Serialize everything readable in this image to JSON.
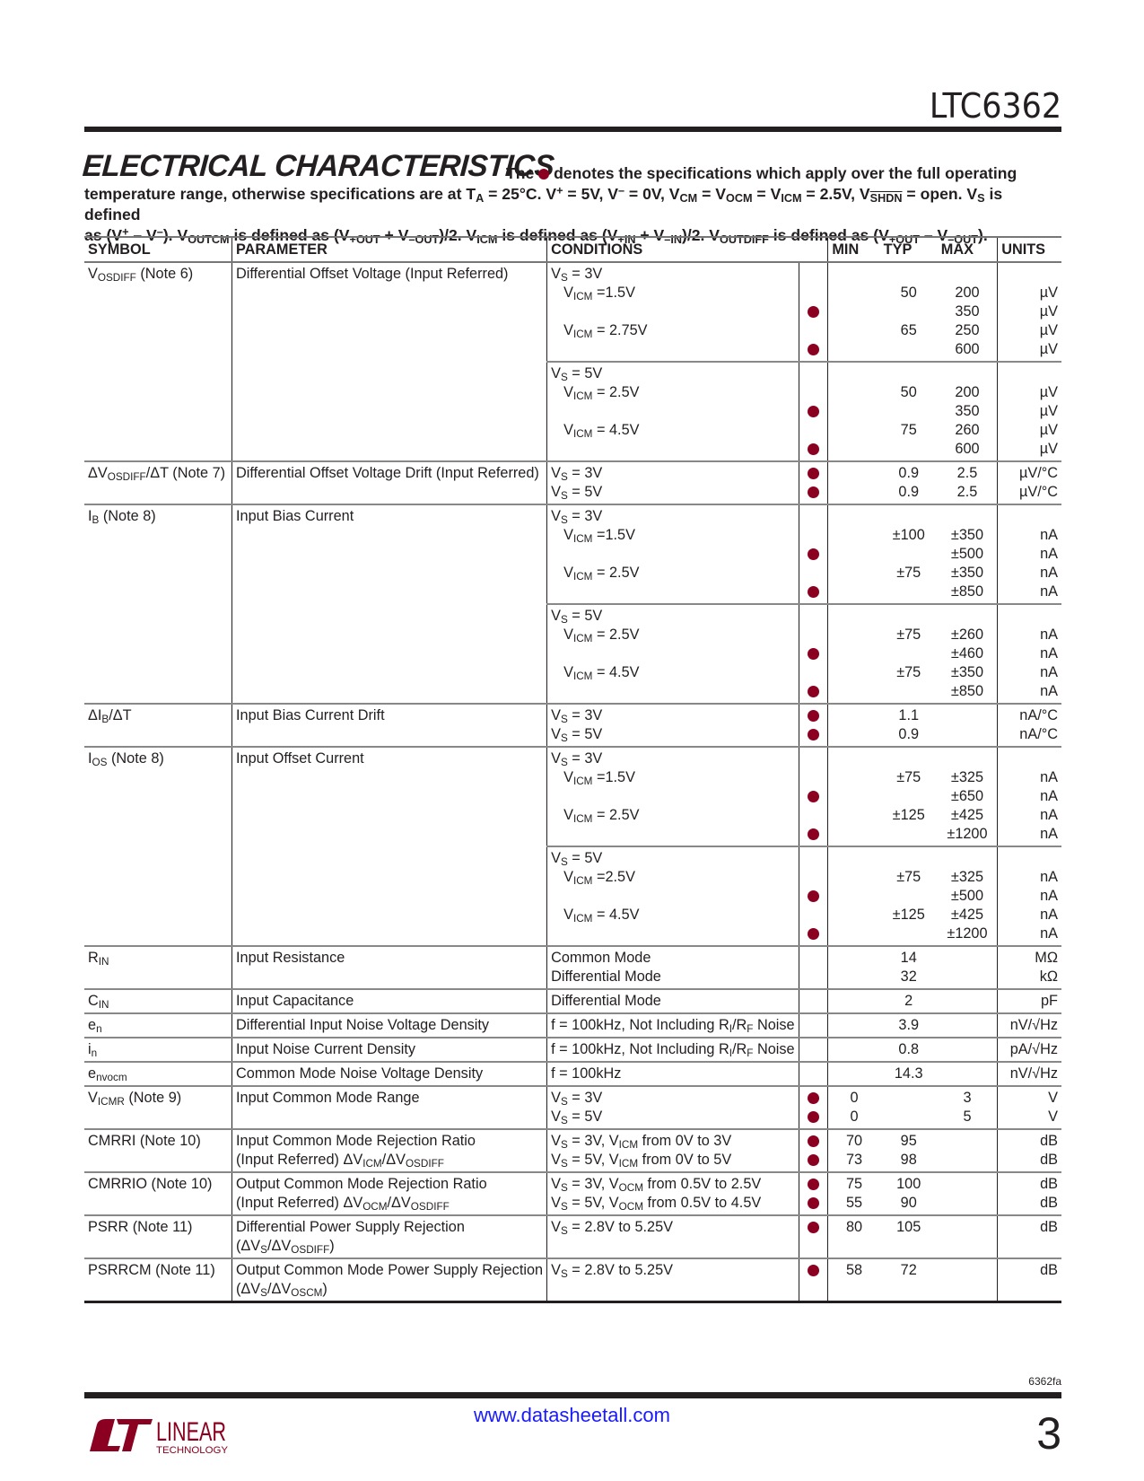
{
  "header": {
    "part_number": "LTC6362"
  },
  "section": {
    "title": "ELECTRICAL CHARACTERISTICS",
    "intro_the": "The",
    "intro_rest_1": "denotes the specifications which apply over the full operating",
    "intro_line_2": "temperature range, otherwise specifications are at T",
    "intro_line_3": "as (V+ – V–). VOUTCM is defined as (V+OUT + V–OUT)/2. VICM is defined as (V+IN + V–IN)/2. VOUTDIFF is defined as (V+OUT – V–OUT)."
  },
  "table": {
    "headers": {
      "symbol": "SYMBOL",
      "parameter": "PARAMETER",
      "conditions": "CONDITIONS",
      "min": "MIN",
      "typ": "TYP",
      "max": "MAX",
      "units": "UNITS"
    },
    "bullet_color": "#8b0020",
    "rows": [
      {
        "symbol": "VOSDIFF (Note 6)",
        "parameter": "Differential Offset Voltage (Input Referred)",
        "groups": [
          {
            "lines": [
              {
                "cond": "VS = 3V",
                "dot": false,
                "min": "",
                "typ": "",
                "max": "",
                "unit": ""
              },
              {
                "cond": "VICM =1.5V",
                "dot": false,
                "min": "",
                "typ": "50",
                "max": "200",
                "unit": "µV"
              },
              {
                "cond": "",
                "dot": true,
                "min": "",
                "typ": "",
                "max": "350",
                "unit": "µV"
              },
              {
                "cond": "VICM = 2.75V",
                "dot": false,
                "min": "",
                "typ": "65",
                "max": "250",
                "unit": "µV"
              },
              {
                "cond": "",
                "dot": true,
                "min": "",
                "typ": "",
                "max": "600",
                "unit": "µV"
              }
            ]
          },
          {
            "lines": [
              {
                "cond": "VS = 5V",
                "dot": false,
                "min": "",
                "typ": "",
                "max": "",
                "unit": ""
              },
              {
                "cond": "VICM = 2.5V",
                "dot": false,
                "min": "",
                "typ": "50",
                "max": "200",
                "unit": "µV"
              },
              {
                "cond": "",
                "dot": true,
                "min": "",
                "typ": "",
                "max": "350",
                "unit": "µV"
              },
              {
                "cond": "VICM = 4.5V",
                "dot": false,
                "min": "",
                "typ": "75",
                "max": "260",
                "unit": "µV"
              },
              {
                "cond": "",
                "dot": true,
                "min": "",
                "typ": "",
                "max": "600",
                "unit": "µV"
              }
            ]
          }
        ]
      },
      {
        "symbol": "ΔVOSDIFF/ΔT (Note 7)",
        "parameter": "Differential Offset Voltage Drift (Input Referred)",
        "groups": [
          {
            "lines": [
              {
                "cond": "VS = 3V",
                "dot": true,
                "min": "",
                "typ": "0.9",
                "max": "2.5",
                "unit": "µV/°C"
              },
              {
                "cond": "VS = 5V",
                "dot": true,
                "min": "",
                "typ": "0.9",
                "max": "2.5",
                "unit": "µV/°C"
              }
            ]
          }
        ]
      },
      {
        "symbol": "IB (Note 8)",
        "parameter": "Input Bias Current",
        "groups": [
          {
            "lines": [
              {
                "cond": "VS = 3V",
                "dot": false,
                "min": "",
                "typ": "",
                "max": "",
                "unit": ""
              },
              {
                "cond": "VICM =1.5V",
                "dot": false,
                "min": "",
                "typ": "±100",
                "max": "±350",
                "unit": "nA"
              },
              {
                "cond": "",
                "dot": true,
                "min": "",
                "typ": "",
                "max": "±500",
                "unit": "nA"
              },
              {
                "cond": "VICM = 2.5V",
                "dot": false,
                "min": "",
                "typ": "±75",
                "max": "±350",
                "unit": "nA"
              },
              {
                "cond": "",
                "dot": true,
                "min": "",
                "typ": "",
                "max": "±850",
                "unit": "nA"
              }
            ]
          },
          {
            "lines": [
              {
                "cond": "VS = 5V",
                "dot": false,
                "min": "",
                "typ": "",
                "max": "",
                "unit": ""
              },
              {
                "cond": "VICM = 2.5V",
                "dot": false,
                "min": "",
                "typ": "±75",
                "max": "±260",
                "unit": "nA"
              },
              {
                "cond": "",
                "dot": true,
                "min": "",
                "typ": "",
                "max": "±460",
                "unit": "nA"
              },
              {
                "cond": "VICM = 4.5V",
                "dot": false,
                "min": "",
                "typ": "±75",
                "max": "±350",
                "unit": "nA"
              },
              {
                "cond": "",
                "dot": true,
                "min": "",
                "typ": "",
                "max": "±850",
                "unit": "nA"
              }
            ]
          }
        ]
      },
      {
        "symbol": "ΔIB/ΔT",
        "parameter": "Input Bias Current Drift",
        "groups": [
          {
            "lines": [
              {
                "cond": "VS = 3V",
                "dot": true,
                "min": "",
                "typ": "1.1",
                "max": "",
                "unit": "nA/°C"
              },
              {
                "cond": "VS = 5V",
                "dot": true,
                "min": "",
                "typ": "0.9",
                "max": "",
                "unit": "nA/°C"
              }
            ]
          }
        ]
      },
      {
        "symbol": "IOS (Note 8)",
        "parameter": "Input Offset Current",
        "groups": [
          {
            "lines": [
              {
                "cond": "VS = 3V",
                "dot": false,
                "min": "",
                "typ": "",
                "max": "",
                "unit": ""
              },
              {
                "cond": "VICM =1.5V",
                "dot": false,
                "min": "",
                "typ": "±75",
                "max": "±325",
                "unit": "nA"
              },
              {
                "cond": "",
                "dot": true,
                "min": "",
                "typ": "",
                "max": "±650",
                "unit": "nA"
              },
              {
                "cond": "VICM = 2.5V",
                "dot": false,
                "min": "",
                "typ": "±125",
                "max": "±425",
                "unit": "nA"
              },
              {
                "cond": "",
                "dot": true,
                "min": "",
                "typ": "",
                "max": "±1200",
                "unit": "nA"
              }
            ]
          },
          {
            "lines": [
              {
                "cond": "VS = 5V",
                "dot": false,
                "min": "",
                "typ": "",
                "max": "",
                "unit": ""
              },
              {
                "cond": "VICM =2.5V",
                "dot": false,
                "min": "",
                "typ": "±75",
                "max": "±325",
                "unit": "nA"
              },
              {
                "cond": "",
                "dot": true,
                "min": "",
                "typ": "",
                "max": "±500",
                "unit": "nA"
              },
              {
                "cond": "VICM = 4.5V",
                "dot": false,
                "min": "",
                "typ": "±125",
                "max": "±425",
                "unit": "nA"
              },
              {
                "cond": "",
                "dot": true,
                "min": "",
                "typ": "",
                "max": "±1200",
                "unit": "nA"
              }
            ]
          }
        ]
      },
      {
        "symbol": "RIN",
        "parameter": "Input Resistance",
        "groups": [
          {
            "lines": [
              {
                "cond": "Common Mode",
                "dot": false,
                "min": "",
                "typ": "14",
                "max": "",
                "unit": "MΩ"
              },
              {
                "cond": "Differential Mode",
                "dot": false,
                "min": "",
                "typ": "32",
                "max": "",
                "unit": "kΩ"
              }
            ]
          }
        ]
      },
      {
        "symbol": "CIN",
        "parameter": "Input Capacitance",
        "groups": [
          {
            "lines": [
              {
                "cond": "Differential Mode",
                "dot": false,
                "min": "",
                "typ": "2",
                "max": "",
                "unit": "pF"
              }
            ]
          }
        ]
      },
      {
        "symbol": "en",
        "parameter": "Differential Input Noise Voltage Density",
        "groups": [
          {
            "lines": [
              {
                "cond": "f = 100kHz, Not Including RI/RF Noise",
                "dot": false,
                "min": "",
                "typ": "3.9",
                "max": "",
                "unit": "nV/√Hz"
              }
            ]
          }
        ]
      },
      {
        "symbol": "in",
        "parameter": "Input Noise Current Density",
        "groups": [
          {
            "lines": [
              {
                "cond": "f = 100kHz, Not Including RI/RF Noise",
                "dot": false,
                "min": "",
                "typ": "0.8",
                "max": "",
                "unit": "pA/√Hz"
              }
            ]
          }
        ]
      },
      {
        "symbol": "envocm",
        "parameter": "Common Mode Noise Voltage Density",
        "groups": [
          {
            "lines": [
              {
                "cond": "f = 100kHz",
                "dot": false,
                "min": "",
                "typ": "14.3",
                "max": "",
                "unit": "nV/√Hz"
              }
            ]
          }
        ]
      },
      {
        "symbol": "VICMR (Note 9)",
        "parameter": "Input Common Mode Range",
        "groups": [
          {
            "lines": [
              {
                "cond": "VS = 3V",
                "dot": true,
                "min": "0",
                "typ": "",
                "max": "3",
                "unit": "V"
              },
              {
                "cond": "VS = 5V",
                "dot": true,
                "min": "0",
                "typ": "",
                "max": "5",
                "unit": "V"
              }
            ]
          }
        ]
      },
      {
        "symbol": "CMRRI (Note 10)",
        "parameter": "Input Common Mode Rejection Ratio",
        "parameter_2": "(Input Referred) ΔVICM/ΔVOSDIFF",
        "groups": [
          {
            "lines": [
              {
                "cond": "VS = 3V, VICM from 0V to 3V",
                "dot": true,
                "min": "70",
                "typ": "95",
                "max": "",
                "unit": "dB"
              },
              {
                "cond": "VS = 5V, VICM from 0V to 5V",
                "dot": true,
                "min": "73",
                "typ": "98",
                "max": "",
                "unit": "dB"
              }
            ]
          }
        ]
      },
      {
        "symbol": "CMRRIO (Note 10)",
        "parameter": "Output Common Mode Rejection Ratio",
        "parameter_2": "(Input Referred) ΔVOCM/ΔVOSDIFF",
        "groups": [
          {
            "lines": [
              {
                "cond": "VS = 3V, VOCM from 0.5V to 2.5V",
                "dot": true,
                "min": "75",
                "typ": "100",
                "max": "",
                "unit": "dB"
              },
              {
                "cond": "VS = 5V, VOCM from 0.5V to 4.5V",
                "dot": true,
                "min": "55",
                "typ": "90",
                "max": "",
                "unit": "dB"
              }
            ]
          }
        ]
      },
      {
        "symbol": "PSRR (Note 11)",
        "parameter": "Differential Power Supply Rejection",
        "parameter_2": "(ΔVS/ΔVOSDIFF)",
        "groups": [
          {
            "lines": [
              {
                "cond": "VS = 2.8V to 5.25V",
                "dot": true,
                "min": "80",
                "typ": "105",
                "max": "",
                "unit": "dB"
              },
              {
                "cond": "",
                "dot": false,
                "min": "",
                "typ": "",
                "max": "",
                "unit": ""
              }
            ]
          }
        ]
      },
      {
        "symbol": "PSRRCM (Note 11)",
        "parameter": "Output Common Mode Power Supply Rejection",
        "parameter_2": "(ΔVS/ΔVOSCM)",
        "groups": [
          {
            "lines": [
              {
                "cond": "VS = 2.8V to 5.25V",
                "dot": true,
                "min": "58",
                "typ": "72",
                "max": "",
                "unit": "dB"
              },
              {
                "cond": "",
                "dot": false,
                "min": "",
                "typ": "",
                "max": "",
                "unit": ""
              }
            ]
          }
        ]
      }
    ]
  },
  "footer": {
    "doc_code": "6362fa",
    "url": "www.datasheetall.com",
    "page_number": "3",
    "logo_text_1": "LINEAR",
    "logo_text_2": "TECHNOLOGY",
    "brand_color": "#8b0020",
    "url_color": "#1a1aff"
  }
}
